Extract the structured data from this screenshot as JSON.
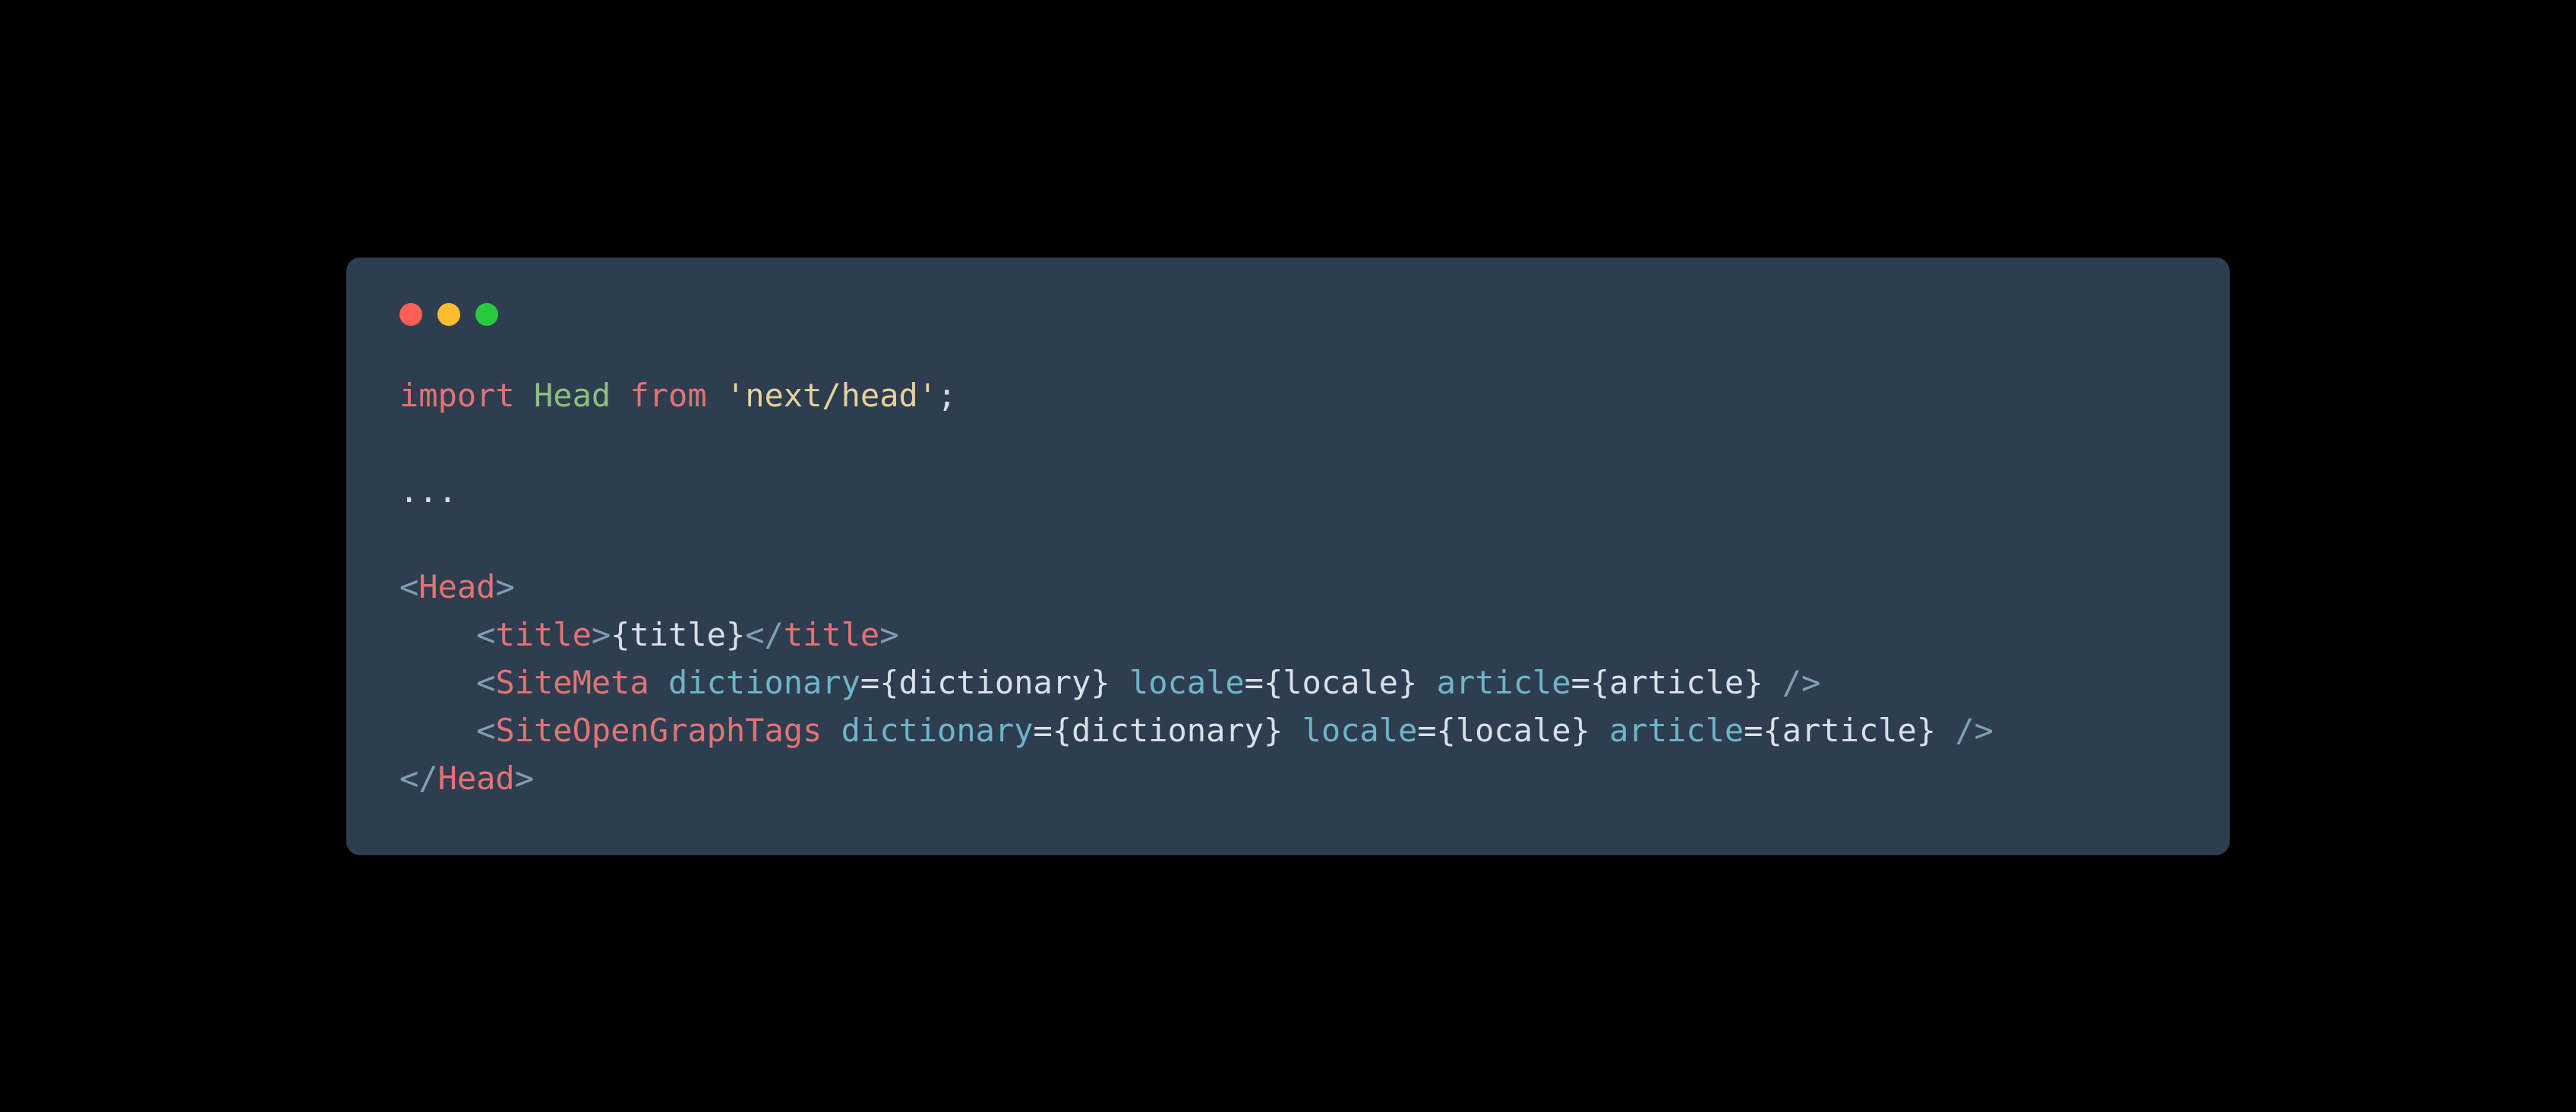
{
  "code": {
    "line1": {
      "import": "import",
      "head": "Head",
      "from": "from",
      "q1": "'",
      "pkg": "next/head",
      "q2": "'",
      "semi": ";"
    },
    "ellipsis": "...",
    "headOpen": {
      "lt": "<",
      "name": "Head",
      "gt": ">"
    },
    "titleLine": {
      "indent": "    ",
      "openLt": "<",
      "openName": "title",
      "openGt": ">",
      "expr": "{title}",
      "closeLt": "</",
      "closeName": "title",
      "closeGt": ">"
    },
    "siteMeta": {
      "indent": "    ",
      "lt": "<",
      "name": "SiteMeta",
      "a1": "dictionary",
      "eq1": "=",
      "v1": "{dictionary}",
      "a2": "locale",
      "eq2": "=",
      "v2": "{locale}",
      "a3": "article",
      "eq3": "=",
      "v3": "{article}",
      "end": "/>"
    },
    "siteOg": {
      "indent": "    ",
      "lt": "<",
      "name": "SiteOpenGraphTags",
      "a1": "dictionary",
      "eq1": "=",
      "v1": "{dictionary}",
      "a2": "locale",
      "eq2": "=",
      "v2": "{locale}",
      "a3": "article",
      "eq3": "=",
      "v3": "{article}",
      "end": "/>"
    },
    "headClose": {
      "lt": "</",
      "name": "Head",
      "gt": ">"
    }
  }
}
